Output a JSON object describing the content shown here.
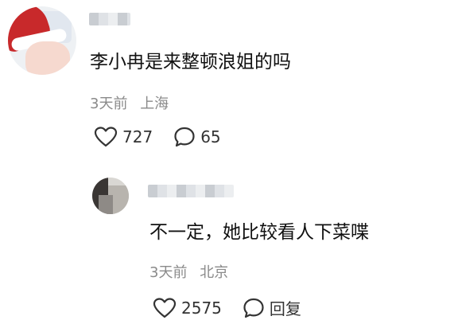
{
  "comment": {
    "text": "李小冉是来整顿浪姐的吗",
    "time": "3天前",
    "location": "上海",
    "like_count": "727",
    "reply_count": "65"
  },
  "reply": {
    "text": "不一定，她比较看人下菜喋",
    "time": "3天前",
    "location": "北京",
    "like_count": "2575",
    "reply_label": "回复"
  },
  "icons": {
    "like": "heart-outline-icon",
    "comment": "speech-bubble-icon"
  }
}
